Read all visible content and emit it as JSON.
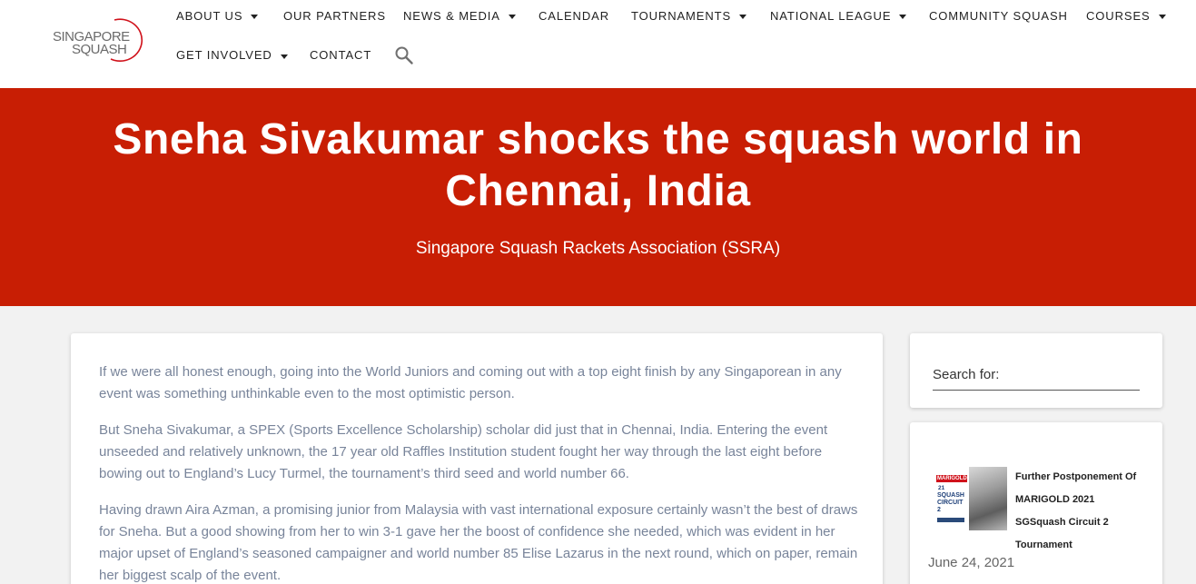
{
  "logo": {
    "line1": "SINGAPORE",
    "line2": "SQUASH",
    "accent": "#d0121b"
  },
  "nav": {
    "items": [
      {
        "label": "ABOUT US",
        "dropdown": true
      },
      {
        "label": "OUR PARTNERS",
        "dropdown": false
      },
      {
        "label": "NEWS & MEDIA",
        "dropdown": true
      },
      {
        "label": "CALENDAR",
        "dropdown": false
      },
      {
        "label": "TOURNAMENTS",
        "dropdown": true
      },
      {
        "label": "NATIONAL LEAGUE",
        "dropdown": true
      },
      {
        "label": "COMMUNITY SQUASH",
        "dropdown": false
      },
      {
        "label": "COURSES",
        "dropdown": true
      },
      {
        "label": "GET INVOLVED",
        "dropdown": true
      },
      {
        "label": "CONTACT",
        "dropdown": false
      }
    ],
    "search_icon": "search-icon"
  },
  "hero": {
    "title": "Sneha Sivakumar shocks the squash world in Chennai, India",
    "subtitle": "Singapore Squash Rackets Association (SSRA)",
    "background": "#c81e04"
  },
  "article": {
    "paragraphs": [
      "If we were all honest enough, going into the World Juniors and coming out with a top eight finish by any Singaporean in any event was something unthinkable even to the most optimistic person.",
      "But Sneha Sivakumar, a SPEX (Sports Excellence Scholarship) scholar did just that in Chennai, India. Entering the event unseeded and relatively unknown, the 17 year old Raffles Institution student fought her way through the last eight before bowing out to England’s Lucy Turmel, the tournament’s third seed and world number 66.",
      "Having drawn Aira Azman, a promising junior from Malaysia with vast international exposure certainly wasn’t the best of draws for Sneha. But a good showing from her to win 3-1 gave her the boost of confidence she needed, which was evident in her major upset of England’s seasoned campaigner and world number 85 Elise Lazarus in the next round, which on paper, remain her biggest scalp of the event."
    ]
  },
  "sidebar": {
    "search_label": "Search for:",
    "recent_post": {
      "thumbnail": {
        "brand": "MARIGOLD",
        "line1": "21",
        "line2": "SQUASH",
        "line3": "CIRCUIT 2"
      },
      "title": "Further Postponement Of MARIGOLD 2021 SGSquash Circuit 2 Tournament",
      "date": "June 24, 2021"
    }
  }
}
